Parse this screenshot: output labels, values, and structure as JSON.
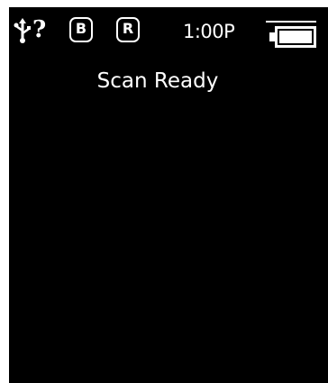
{
  "status_bar": {
    "usb_icon": "usb-icon",
    "unknown_glyph": "?",
    "badge_b": "B",
    "badge_r": "R",
    "time": "1:00P",
    "battery_level": 1.0
  },
  "main": {
    "status_text": "Scan Ready"
  },
  "colors": {
    "background": "#000000",
    "foreground": "#ffffff"
  }
}
